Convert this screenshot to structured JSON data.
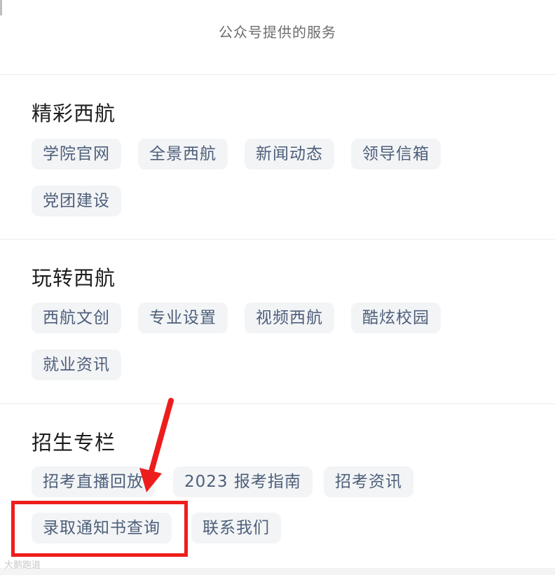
{
  "header": {
    "title": "公众号提供的服务"
  },
  "sections": [
    {
      "title": "精彩西航",
      "items": [
        "学院官网",
        "全景西航",
        "新闻动态",
        "领导信箱",
        "党团建设"
      ]
    },
    {
      "title": "玩转西航",
      "items": [
        "西航文创",
        "专业设置",
        "视频西航",
        "酷炫校园",
        "就业资讯"
      ]
    },
    {
      "title": "招生专栏",
      "items": [
        "招考直播回放",
        "2023 报考指南",
        "招考资讯",
        "录取通知书查询",
        "联系我们"
      ]
    }
  ],
  "annotation": {
    "arrow_color": "#ee1d1d",
    "box_color": "#ee1d1d"
  },
  "watermark": {
    "text": "大鹅跑道"
  }
}
